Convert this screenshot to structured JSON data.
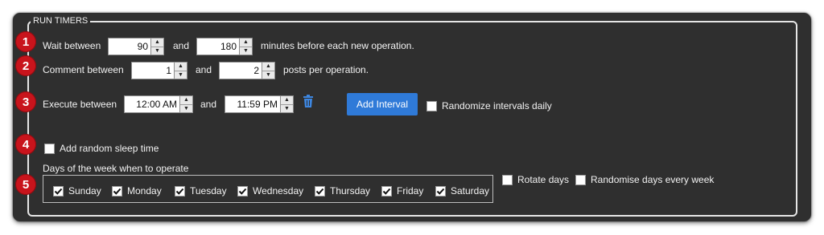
{
  "panel": {
    "title": "RUN TIMERS"
  },
  "badges": [
    "1",
    "2",
    "3",
    "4",
    "5"
  ],
  "wait": {
    "label": "Wait between",
    "min": "90",
    "and": "and",
    "max": "180",
    "suffix": "minutes before each new operation."
  },
  "comment": {
    "label": "Comment between",
    "min": "1",
    "and": "and",
    "max": "2",
    "suffix": "posts per operation."
  },
  "execute": {
    "label": "Execute between",
    "start": "12:00 AM",
    "and": "and",
    "end": "11:59 PM",
    "delete_icon": "trash-icon",
    "add_interval": "Add Interval",
    "randomize_label": "Randomize intervals daily",
    "randomize_checked": false
  },
  "sleep": {
    "label": "Add random sleep time",
    "checked": false
  },
  "days": {
    "heading": "Days of the week when to operate",
    "items": [
      {
        "label": "Sunday",
        "checked": true
      },
      {
        "label": "Monday",
        "checked": true
      },
      {
        "label": "Tuesday",
        "checked": true
      },
      {
        "label": "Wednesday",
        "checked": true
      },
      {
        "label": "Thursday",
        "checked": true
      },
      {
        "label": "Friday",
        "checked": true
      },
      {
        "label": "Saturday",
        "checked": true
      }
    ],
    "rotate_label": "Rotate days",
    "rotate_checked": false,
    "randomise_label": "Randomise days every week",
    "randomise_checked": false
  },
  "colors": {
    "background": "#2f2f2f",
    "badge": "#c8141c",
    "button": "#2f7ad8"
  }
}
